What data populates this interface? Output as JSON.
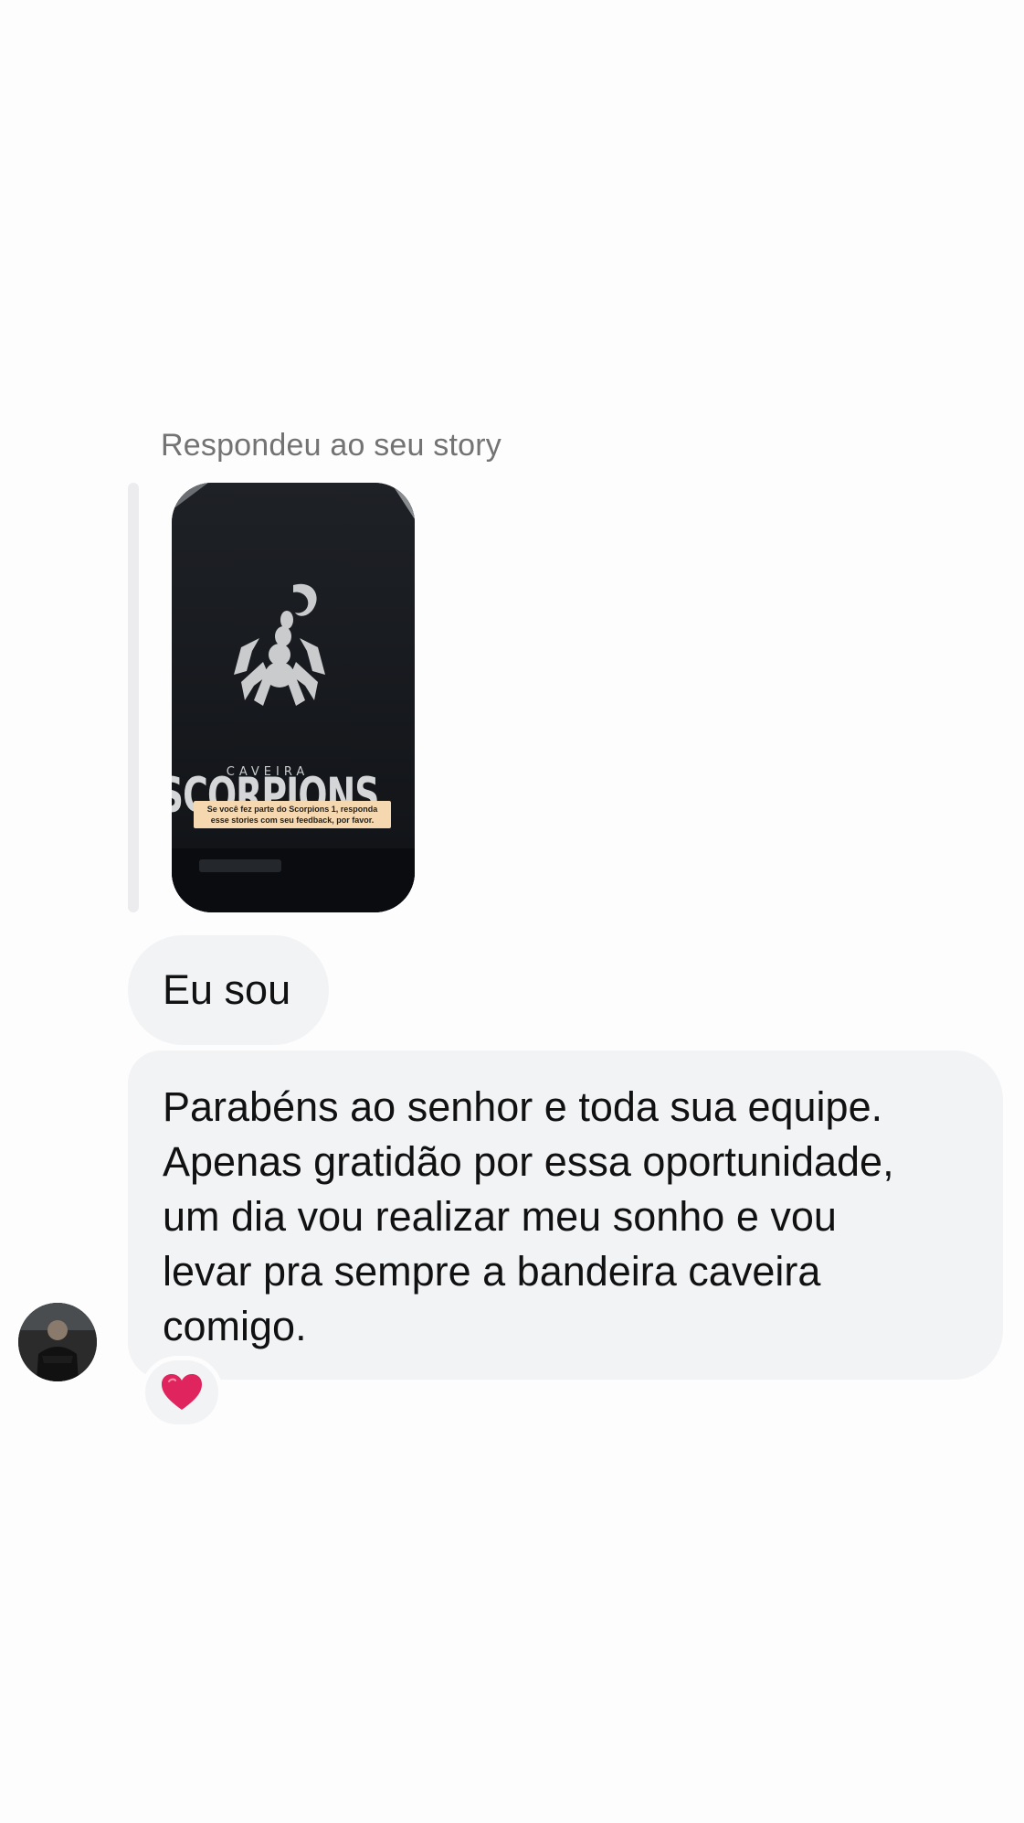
{
  "conversation": {
    "reply_label": "Respondeu ao seu story",
    "story": {
      "brand_main": "SCORPIONS",
      "brand_sub": "CAVEIRA",
      "caption_line1": "Se você fez parte do Scorpions 1, responda",
      "caption_line2": "esse stories com seu feedback, por favor."
    },
    "messages": [
      {
        "text": "Eu sou"
      },
      {
        "lines": [
          "Parabéns ao senhor e toda sua equipe.",
          "Apenas gratidão por essa oportunidade,",
          "um dia vou realizar meu sonho e vou",
          "levar pra sempre a bandeira caveira",
          "comigo."
        ]
      }
    ],
    "reaction": {
      "icon": "heart-icon",
      "color": "#e0245e"
    }
  }
}
